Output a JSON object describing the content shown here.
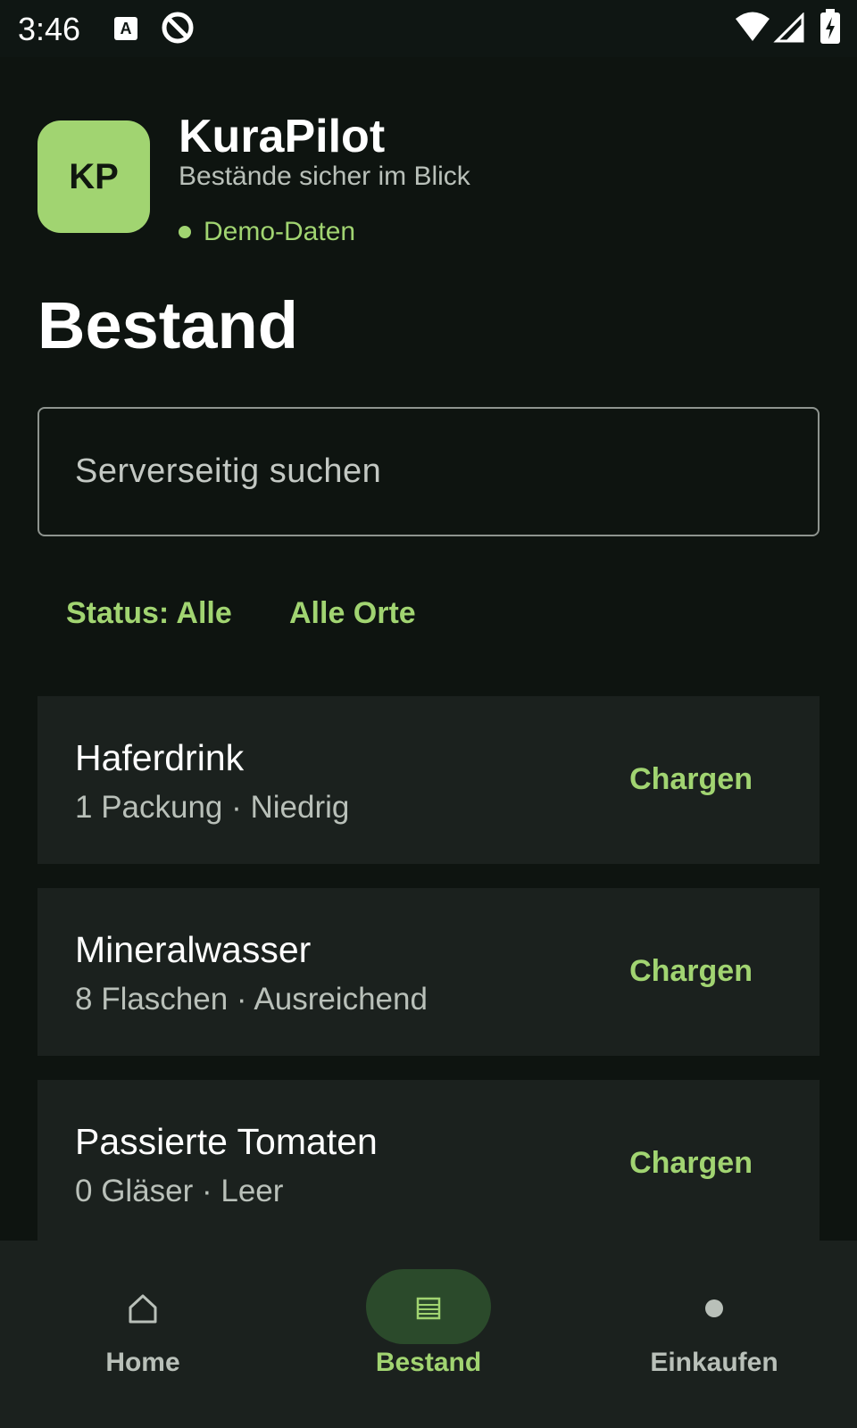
{
  "status_bar": {
    "time": "3:46",
    "icons": [
      "text-a-icon",
      "no-entry-circle-icon",
      "wifi-icon",
      "signal-icon",
      "battery-charging-icon"
    ]
  },
  "app": {
    "logo_text": "KP",
    "name": "KuraPilot",
    "tagline": "Bestände sicher im Blick",
    "badge": "Demo-Daten",
    "accent_color": "#a1d471"
  },
  "page": {
    "title": "Bestand"
  },
  "search": {
    "placeholder": "Serverseitig suchen",
    "value": ""
  },
  "filters": {
    "status": "Status: Alle",
    "locations": "Alle Orte"
  },
  "items": [
    {
      "name": "Haferdrink",
      "detail": "1 Packung · Niedrig",
      "action": "Chargen"
    },
    {
      "name": "Mineralwasser",
      "detail": "8 Flaschen · Ausreichend",
      "action": "Chargen"
    },
    {
      "name": "Passierte Tomaten",
      "detail": "0 Gläser · Leer",
      "action": "Chargen"
    }
  ],
  "nav": {
    "items": [
      {
        "label": "Home",
        "icon": "home-icon"
      },
      {
        "label": "Bestand",
        "icon": "list-icon",
        "active": true
      },
      {
        "label": "Einkaufen",
        "icon": "dot-icon"
      }
    ]
  }
}
